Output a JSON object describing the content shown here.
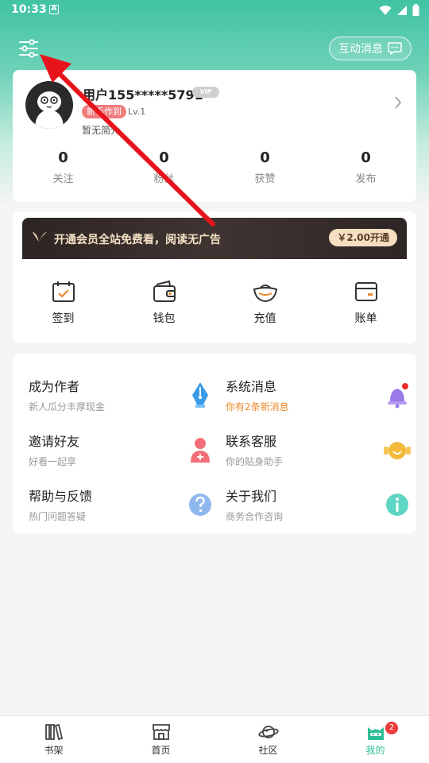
{
  "status_bar": {
    "time": "10:33",
    "app_badge": "A"
  },
  "header": {
    "message_button": "互动消息"
  },
  "profile": {
    "username": "用户155*****5791",
    "vip_tag": "VIP",
    "newbie_badge": "新手作到",
    "level": "Lv.1",
    "bio": "暂无简介",
    "stats": [
      {
        "value": "0",
        "label": "关注"
      },
      {
        "value": "0",
        "label": "粉丝"
      },
      {
        "value": "0",
        "label": "获赞"
      },
      {
        "value": "0",
        "label": "发布"
      }
    ]
  },
  "vip_banner": {
    "text": "开通会员全站免费看，阅读无广告",
    "button": "￥2.00开通"
  },
  "quick_actions": [
    {
      "label": "签到",
      "icon": "calendar-check-icon"
    },
    {
      "label": "钱包",
      "icon": "wallet-icon"
    },
    {
      "label": "充值",
      "icon": "gold-ingot-icon"
    },
    {
      "label": "账单",
      "icon": "bill-card-icon"
    }
  ],
  "menu_items": [
    {
      "title": "成为作者",
      "subtitle": "新人瓜分丰厚现金",
      "icon": "pen-nib-icon"
    },
    {
      "title": "系统消息",
      "subtitle": "你有2条新消息",
      "icon": "bell-icon",
      "accent": "#f08a2c"
    },
    {
      "title": "邀请好友",
      "subtitle": "好看一起享",
      "icon": "add-friend-icon"
    },
    {
      "title": "联系客服",
      "subtitle": "你的贴身助手",
      "icon": "headset-icon"
    },
    {
      "title": "帮助与反馈",
      "subtitle": "热门问题答疑",
      "icon": "question-icon"
    },
    {
      "title": "关于我们",
      "subtitle": "商务合作咨询",
      "icon": "info-icon"
    }
  ],
  "tabbar": {
    "tabs": [
      {
        "label": "书架",
        "icon": "bookshelf-icon"
      },
      {
        "label": "首页",
        "icon": "store-icon"
      },
      {
        "label": "社区",
        "icon": "planet-icon"
      },
      {
        "label": "我的",
        "icon": "profile-cat-icon",
        "active": true,
        "badge": "2"
      }
    ]
  },
  "colors": {
    "accent": "#2fbf97",
    "header_gradient_top": "#41c3a4",
    "annotation_arrow": "#e8141c"
  }
}
